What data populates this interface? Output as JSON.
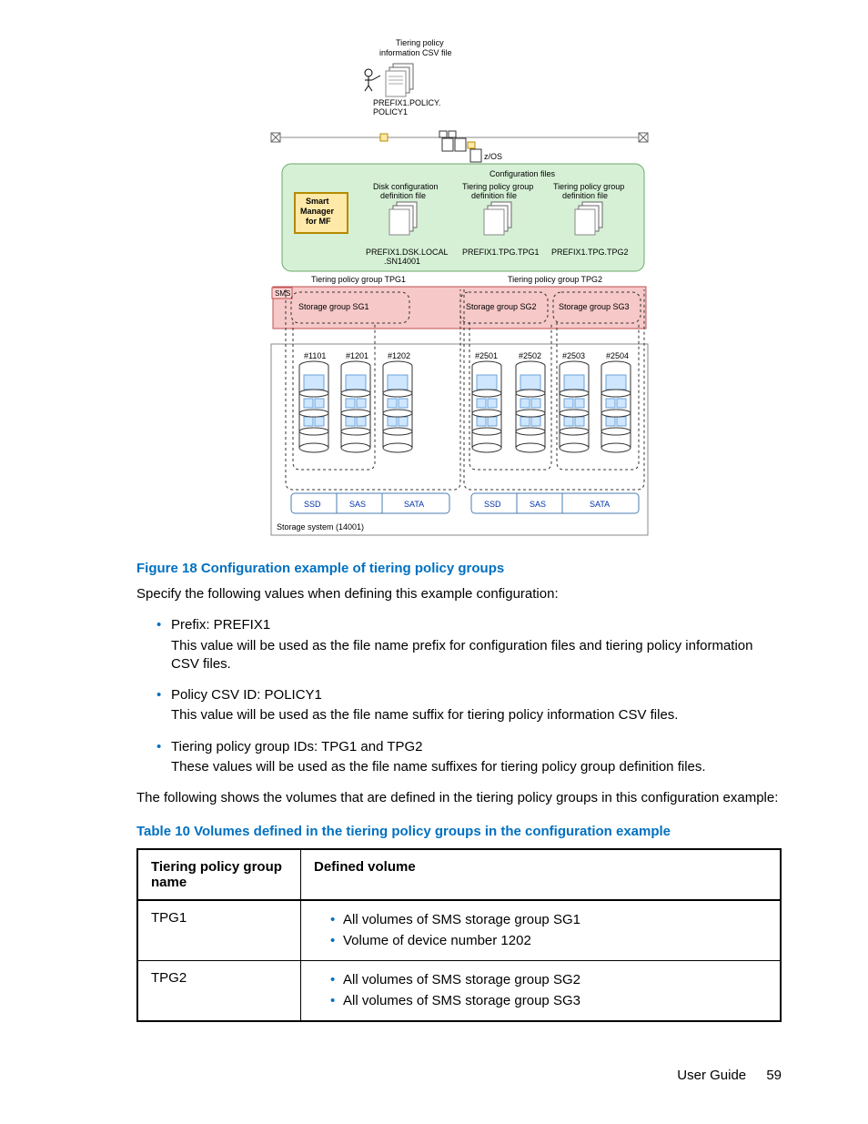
{
  "diagram": {
    "tiering_policy_label1": "Tiering policy",
    "tiering_policy_label2": "information CSV file",
    "prefix_policy1": "PREFIX1.POLICY.",
    "prefix_policy2": "POLICY1",
    "zos_label": "z/OS",
    "config_files_label": "Configuration files",
    "smart_mgr1": "Smart",
    "smart_mgr2": "Manager",
    "smart_mgr3": "for MF",
    "disk_cfg1": "Disk configuration",
    "disk_cfg2": "definition file",
    "tpg_def1": "Tiering policy group",
    "tpg_def2": "definition file",
    "file_dsk1": "PREFIX1.DSK.LOCAL",
    "file_dsk2": ".SN14001",
    "file_tpg1": "PREFIX1.TPG.TPG1",
    "file_tpg2": "PREFIX1.TPG.TPG2",
    "tpg_group1": "Tiering policy group TPG1",
    "tpg_group2": "Tiering policy group TPG2",
    "sms_label": "SMS",
    "sg1": "Storage group SG1",
    "sg2": "Storage group SG2",
    "sg3": "Storage group SG3",
    "dev1101": "#1101",
    "dev1201": "#1201",
    "dev1202": "#1202",
    "dev2501": "#2501",
    "dev2502": "#2502",
    "dev2503": "#2503",
    "dev2504": "#2504",
    "ssd": "SSD",
    "sas": "SAS",
    "sata": "SATA",
    "storage_system": "Storage system (14001)"
  },
  "figure_caption": "Figure 18 Configuration example of tiering policy groups",
  "intro": "Specify the following values when defining this example configuration:",
  "bullets": [
    {
      "head": "Prefix: PREFIX1",
      "sub": "This value will be used as the file name prefix for configuration files and tiering policy information CSV files."
    },
    {
      "head": "Policy CSV ID: POLICY1",
      "sub": "This value will be used as the file name suffix for tiering policy information CSV files."
    },
    {
      "head": "Tiering policy group IDs: TPG1 and TPG2",
      "sub": "These values will be used as the file name suffixes for tiering policy group definition files."
    }
  ],
  "between": "The following shows the volumes that are defined in the tiering policy groups in this configuration example:",
  "table_caption": "Table 10 Volumes defined in the tiering policy groups in the configuration example",
  "table": {
    "h1": "Tiering policy group name",
    "h2": "Defined volume",
    "rows": [
      {
        "name": "TPG1",
        "items": [
          "All volumes of SMS storage group SG1",
          "Volume of device number 1202"
        ]
      },
      {
        "name": "TPG2",
        "items": [
          "All volumes of SMS storage group SG2",
          "All volumes of SMS storage group SG3"
        ]
      }
    ]
  },
  "footer": {
    "guide": "User Guide",
    "page": "59"
  }
}
